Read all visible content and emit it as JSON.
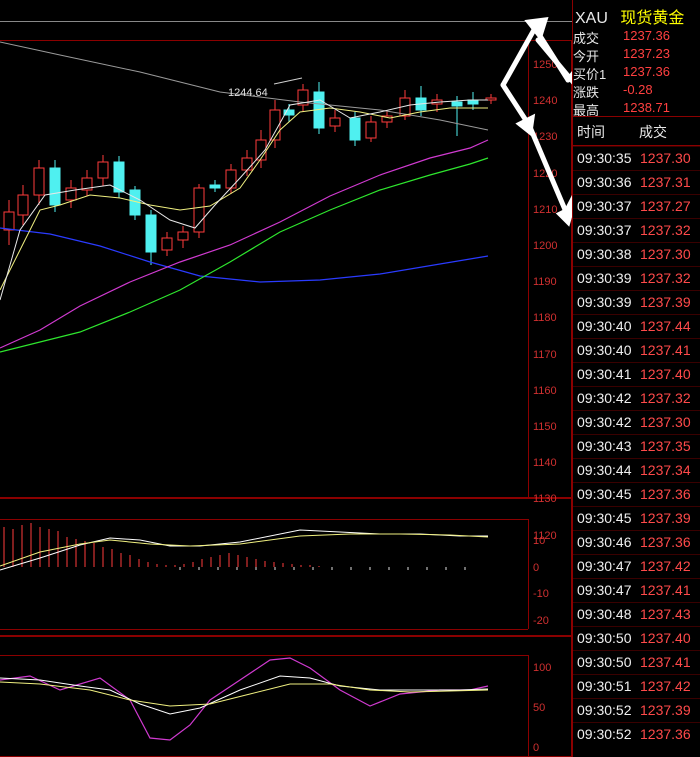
{
  "symbol": {
    "code": "XAU",
    "name": "现货黄金"
  },
  "quote": [
    {
      "label": "成交",
      "value": "1237.36"
    },
    {
      "label": "今开",
      "value": "1237.23"
    },
    {
      "label": "买价1",
      "value": "1237.36"
    },
    {
      "label": "涨跌",
      "value": "-0.28"
    },
    {
      "label": "最高",
      "value": "1238.71"
    }
  ],
  "trades_header": {
    "time": "时间",
    "price": "成交"
  },
  "trades": [
    {
      "time": "09:30:35",
      "price": "1237.30"
    },
    {
      "time": "09:30:36",
      "price": "1237.31"
    },
    {
      "time": "09:30:37",
      "price": "1237.27"
    },
    {
      "time": "09:30:37",
      "price": "1237.32"
    },
    {
      "time": "09:30:38",
      "price": "1237.30"
    },
    {
      "time": "09:30:39",
      "price": "1237.32"
    },
    {
      "time": "09:30:39",
      "price": "1237.39"
    },
    {
      "time": "09:30:40",
      "price": "1237.44"
    },
    {
      "time": "09:30:40",
      "price": "1237.41"
    },
    {
      "time": "09:30:41",
      "price": "1237.40"
    },
    {
      "time": "09:30:42",
      "price": "1237.32"
    },
    {
      "time": "09:30:42",
      "price": "1237.30"
    },
    {
      "time": "09:30:43",
      "price": "1237.35"
    },
    {
      "time": "09:30:44",
      "price": "1237.34"
    },
    {
      "time": "09:30:45",
      "price": "1237.36"
    },
    {
      "time": "09:30:45",
      "price": "1237.39"
    },
    {
      "time": "09:30:46",
      "price": "1237.36"
    },
    {
      "time": "09:30:47",
      "price": "1237.42"
    },
    {
      "time": "09:30:47",
      "price": "1237.41"
    },
    {
      "time": "09:30:48",
      "price": "1237.43"
    },
    {
      "time": "09:30:50",
      "price": "1237.40"
    },
    {
      "time": "09:30:50",
      "price": "1237.41"
    },
    {
      "time": "09:30:51",
      "price": "1237.42"
    },
    {
      "time": "09:30:52",
      "price": "1237.39"
    },
    {
      "time": "09:30:52",
      "price": "1237.36"
    }
  ],
  "chart_annotation": "1244.64",
  "price_axis": [
    "1250",
    "1240",
    "1230",
    "1220",
    "1210",
    "1200",
    "1190",
    "1180",
    "1170",
    "1160",
    "1150",
    "1140",
    "1130",
    "1120"
  ],
  "macd_axis": [
    "10",
    "0",
    "-10",
    "-20"
  ],
  "kdj_axis": [
    "100",
    "50",
    "0"
  ],
  "colors": {
    "up": "#ff3b3b",
    "down": "#4ff0f0",
    "axis": "#d03030",
    "border": "#8b0000",
    "accent": "#ffff00"
  }
}
